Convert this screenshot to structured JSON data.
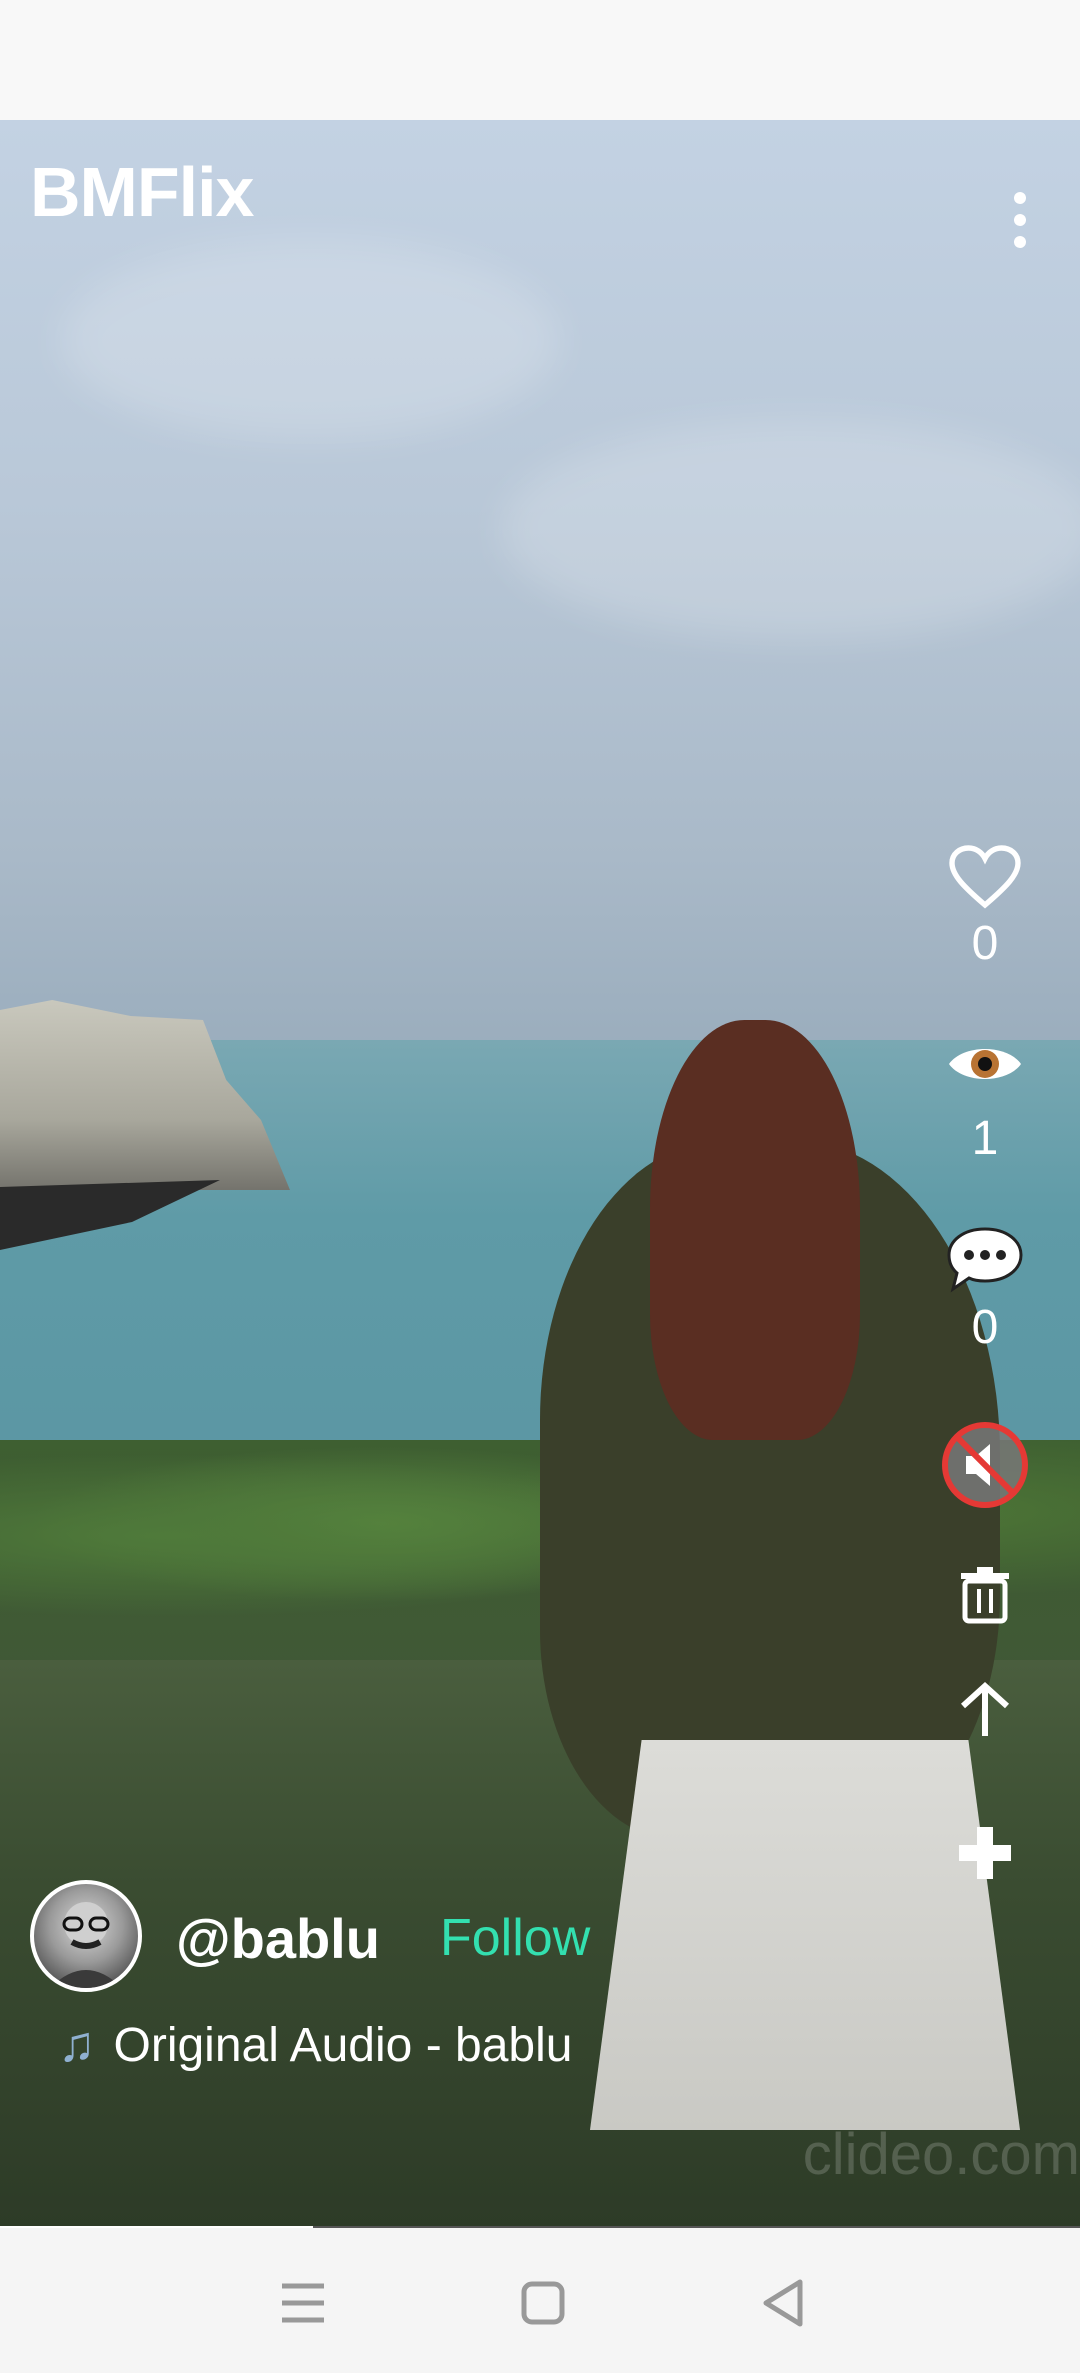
{
  "app": {
    "title": "BMFlix"
  },
  "actions": {
    "likes": "0",
    "views": "1",
    "comments": "0"
  },
  "post": {
    "username": "@bablu",
    "follow_label": "Follow",
    "audio_label": "Original Audio - bablu",
    "watermark": "clideo.com",
    "progress": 0.29
  },
  "icons": {
    "menu": "more-vertical-icon",
    "like": "heart-icon",
    "views": "eye-icon",
    "comment": "speech-bubble-icon",
    "mute": "muted-speaker-icon",
    "delete": "trash-icon",
    "share": "arrow-up-icon",
    "add": "plus-icon",
    "audio": "music-note-icon"
  },
  "colors": {
    "follow": "#33e0b0",
    "mute_ring": "#e53935"
  }
}
